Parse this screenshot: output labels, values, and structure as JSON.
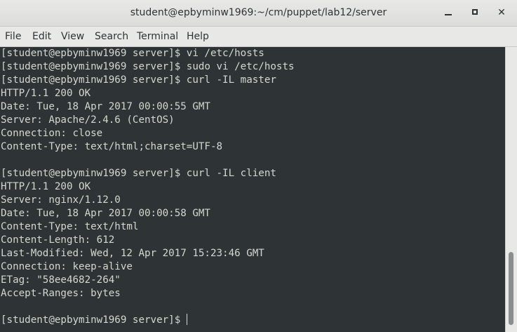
{
  "window": {
    "title": "student@epbyminw1969:~/cm/puppet/lab12/server",
    "minimize_glyph": "",
    "maximize_glyph": "",
    "close_glyph": "✕"
  },
  "menu": {
    "items": [
      "File",
      "Edit",
      "View",
      "Search",
      "Terminal",
      "Help"
    ]
  },
  "terminal": {
    "lines": [
      "[student@epbyminw1969 server]$ vi /etc/hosts",
      "[student@epbyminw1969 server]$ sudo vi /etc/hosts",
      "[student@epbyminw1969 server]$ curl -IL master",
      "HTTP/1.1 200 OK",
      "Date: Tue, 18 Apr 2017 00:00:55 GMT",
      "Server: Apache/2.4.6 (CentOS)",
      "Connection: close",
      "Content-Type: text/html;charset=UTF-8",
      "",
      "[student@epbyminw1969 server]$ curl -IL client",
      "HTTP/1.1 200 OK",
      "Server: nginx/1.12.0",
      "Date: Tue, 18 Apr 2017 00:00:58 GMT",
      "Content-Type: text/html",
      "Content-Length: 612",
      "Last-Modified: Wed, 12 Apr 2017 15:23:46 GMT",
      "Connection: keep-alive",
      "ETag: \"58ee4682-264\"",
      "Accept-Ranges: bytes",
      "",
      "[student@epbyminw1969 server]$ "
    ]
  },
  "colors": {
    "terminal_bg": "#2e3436",
    "terminal_fg": "#d3d7cf",
    "chrome_bg": "#e8e8e7"
  }
}
